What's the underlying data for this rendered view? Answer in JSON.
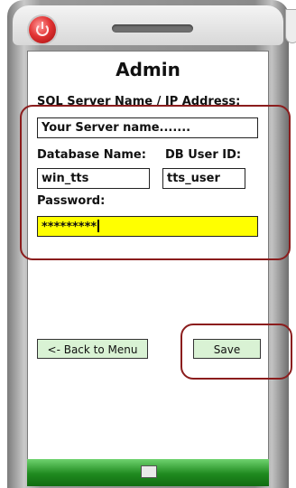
{
  "header": {
    "power_icon": "power-icon",
    "speaker_icon": "speaker-grill"
  },
  "form": {
    "title": "Admin",
    "server_label": "SQL Server Name / IP Address:",
    "server_value": "Your Server name.......",
    "db_name_label": "Database Name:",
    "db_user_label": "DB User ID:",
    "db_name_value": "win_tts",
    "db_user_value": "tts_user",
    "password_label": "Password:",
    "password_value": "*********"
  },
  "buttons": {
    "back_label": "<- Back to Menu",
    "save_label": "Save"
  },
  "colors": {
    "password_bg": "#ffff00",
    "button_bg": "#d9f2d4",
    "highlight": "#8b1d1d",
    "bottom_bar": "#1f8a1f"
  },
  "footer": {
    "keyboard_icon": "keyboard-icon"
  }
}
